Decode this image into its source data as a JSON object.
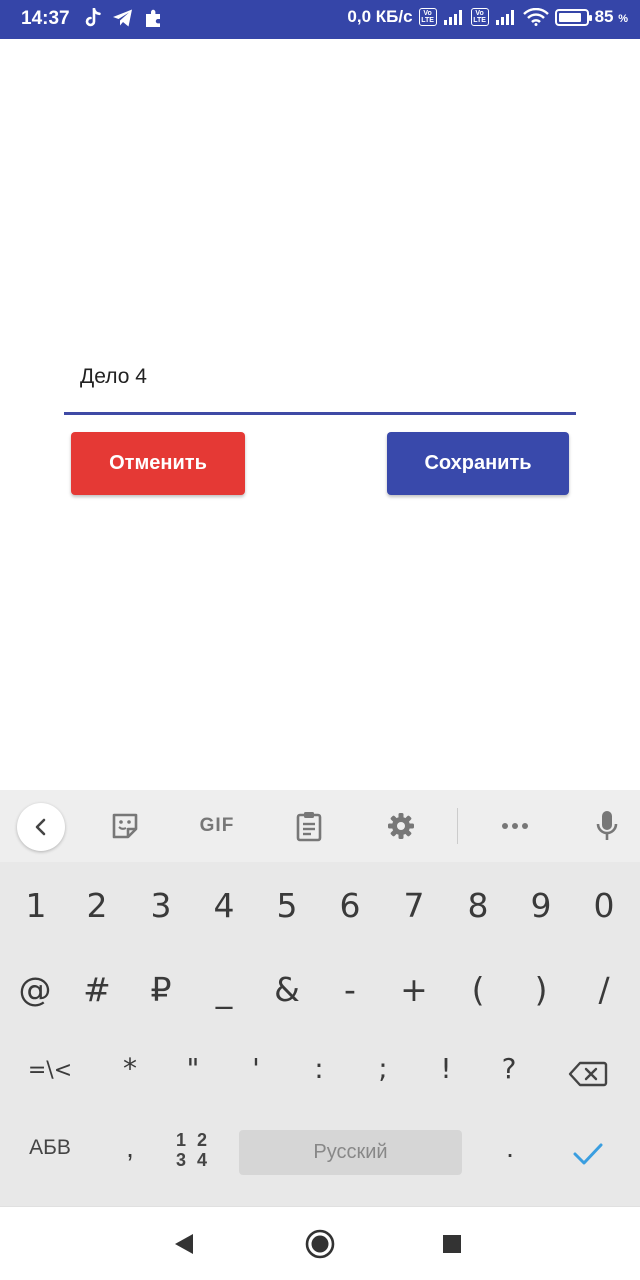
{
  "status_bar": {
    "time": "14:37",
    "network_speed": "0,0 КБ/с",
    "volte1_top": "Vo",
    "volte1_bottom": "LTE",
    "volte2_top": "Vo",
    "volte2_bottom": "LTE",
    "battery_percent": "85",
    "battery_percent_sign": "%",
    "battery_level": 0.85,
    "icons": [
      "tiktok-icon",
      "telegram-icon",
      "puzzle-icon",
      "signal-icon",
      "wifi-icon",
      "battery-icon"
    ]
  },
  "editor": {
    "field_value": "Дело 4"
  },
  "buttons": {
    "cancel_label": "Отменить",
    "save_label": "Сохранить",
    "cancel_color": "#e53935",
    "save_color": "#3949ab"
  },
  "keyboard": {
    "toolbar": {
      "gif_label": "GIF",
      "icons": [
        "back-icon",
        "sticker-icon",
        "gif-icon",
        "clipboard-icon",
        "settings-icon",
        "more-icon",
        "mic-icon"
      ]
    },
    "row1": [
      "1",
      "2",
      "3",
      "4",
      "5",
      "6",
      "7",
      "8",
      "9",
      "0"
    ],
    "row2": [
      "@",
      "#",
      "₽",
      "_",
      "&",
      "-",
      "+",
      "(",
      ")",
      "/"
    ],
    "row3": [
      "=\\<",
      "*",
      "\"",
      "'",
      ":",
      ";",
      "!",
      "?"
    ],
    "abv_label": "АБВ",
    "comma": ",",
    "numpad_label_top": "1 2",
    "numpad_label_bottom": "3 4",
    "space_label": "Русский",
    "period": ".",
    "accent_color": "#3a9ee0"
  }
}
